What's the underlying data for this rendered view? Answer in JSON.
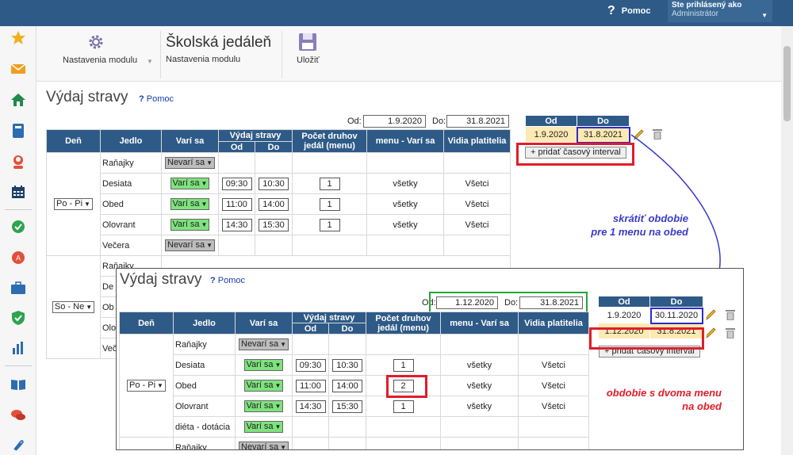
{
  "header": {
    "help": "Pomoc",
    "user_label": "Ste prihlásený ako",
    "user_role": "Administrátor"
  },
  "toolbar": {
    "settings_label": "Nastavenia modulu",
    "title": "Školská jedáleň",
    "subtitle": "Nastavenia modulu",
    "save_label": "Uložiť"
  },
  "main": {
    "title": "Výdaj stravy",
    "help": "Pomoc",
    "from_label": "Od:",
    "from_value": "1.9.2020",
    "to_label": "Do:",
    "to_value": "31.8.2021",
    "columns": {
      "day": "Deň",
      "meal": "Jedlo",
      "cooks": "Varí sa",
      "serving": "Výdaj stravy",
      "serving_from": "Od",
      "serving_to": "Do",
      "count": "Počet druhov",
      "count2": "jedál (menu)",
      "menu_cooks": "menu - Varí sa",
      "visible": "Vidia platitelia"
    },
    "group1_day": "Po - Pi",
    "group2_day": "So - Ne",
    "rows": [
      {
        "meal": "Raňajky",
        "status": "Nevarí sa"
      },
      {
        "meal": "Desiata",
        "status": "Varí sa",
        "from": "09:30",
        "to": "10:30",
        "count": "1",
        "menu": "všetky",
        "visible": "Všetci"
      },
      {
        "meal": "Obed",
        "status": "Varí sa",
        "from": "11:00",
        "to": "14:00",
        "count": "1",
        "menu": "všetky",
        "visible": "Všetci"
      },
      {
        "meal": "Olovrant",
        "status": "Varí sa",
        "from": "14:30",
        "to": "15:30",
        "count": "1",
        "menu": "všetky",
        "visible": "Všetci"
      },
      {
        "meal": "Večera",
        "status": "Nevarí sa"
      }
    ],
    "group2_partial": [
      "Raňajky",
      "De",
      "Ob",
      "Olo",
      "Več"
    ],
    "intervals": {
      "from_header": "Od",
      "to_header": "Do",
      "rows": [
        {
          "from": "1.9.2020",
          "to": "31.8.2021"
        }
      ],
      "add_button": "+ pridať časový interval"
    }
  },
  "inset": {
    "title": "Výdaj stravy",
    "help": "Pomoc",
    "from_label": "Od:",
    "from_value": "1.12.2020",
    "to_label": "Do:",
    "to_value": "31.8.2021",
    "day": "Po - Pi",
    "rows": [
      {
        "meal": "Raňajky",
        "status": "Nevarí sa"
      },
      {
        "meal": "Desiata",
        "status": "Varí sa",
        "from": "09:30",
        "to": "10:30",
        "count": "1",
        "menu": "všetky",
        "visible": "Všetci"
      },
      {
        "meal": "Obed",
        "status": "Varí sa",
        "from": "11:00",
        "to": "14:00",
        "count": "2",
        "menu": "všetky",
        "visible": "Všetci"
      },
      {
        "meal": "Olovrant",
        "status": "Varí sa",
        "from": "14:30",
        "to": "15:30",
        "count": "1",
        "menu": "všetky",
        "visible": "Všetci"
      },
      {
        "meal": "diéta - dotácia",
        "status": "Varí sa"
      },
      {
        "meal": "Raňajky",
        "status": "Nevarí sa"
      }
    ],
    "intervals": {
      "rows": [
        {
          "from": "1.9.2020",
          "to": "30.11.2020"
        },
        {
          "from": "1.12.2020",
          "to": "31.8.2021"
        }
      ],
      "add_button": "+ pridať časový interval"
    }
  },
  "annotations": {
    "shorten_line1": "skrátiť obdobie",
    "shorten_line2": "pre 1 menu na obed",
    "two_menu_line1": "obdobie s dvoma menu",
    "two_menu_line2": "na obed"
  },
  "colors": {
    "header_blue": "#2e5a87",
    "annot_red": "#e11d2a",
    "annot_blue": "#3a3ac8",
    "annot_green": "#24a33b",
    "cooks_green": "#7ee37e",
    "interval_yellow": "#fde9b3"
  },
  "icons": [
    "star-icon",
    "mail-icon",
    "home-icon",
    "book-icon",
    "user-icon",
    "calendar-icon",
    "check-icon",
    "badge-icon",
    "briefcase-icon",
    "shield-icon",
    "chart-icon",
    "open-book-icon",
    "chat-icon",
    "paperclip-icon",
    "gear-icon",
    "save-icon",
    "pencil-icon",
    "trash-icon"
  ]
}
